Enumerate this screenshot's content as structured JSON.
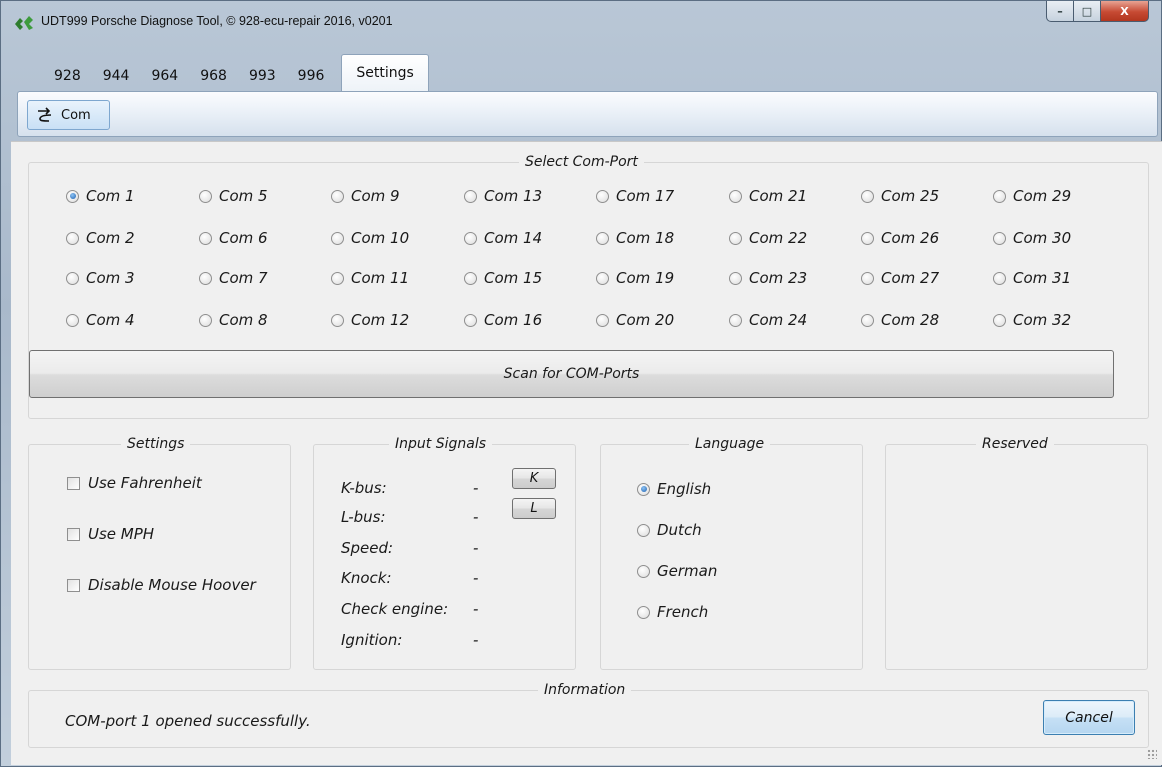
{
  "window": {
    "title": "UDT999 Porsche Diagnose Tool, © 928-ecu-repair 2016, v0201",
    "controls": {
      "minimize": "–",
      "maximize": "□",
      "close": "X"
    }
  },
  "tabs": [
    {
      "label": "928",
      "active": false
    },
    {
      "label": "944",
      "active": false
    },
    {
      "label": "964",
      "active": false
    },
    {
      "label": "968",
      "active": false
    },
    {
      "label": "993",
      "active": false
    },
    {
      "label": "996",
      "active": false
    },
    {
      "label": "Settings",
      "active": true
    }
  ],
  "ribbon": {
    "com_button": "Com"
  },
  "com_port": {
    "title": "Select Com-Port",
    "selected": "Com 1",
    "ports": [
      "Com 1",
      "Com 2",
      "Com 3",
      "Com 4",
      "Com 5",
      "Com 6",
      "Com 7",
      "Com 8",
      "Com 9",
      "Com 10",
      "Com 11",
      "Com 12",
      "Com 13",
      "Com 14",
      "Com 15",
      "Com 16",
      "Com 17",
      "Com 18",
      "Com 19",
      "Com 20",
      "Com 21",
      "Com 22",
      "Com 23",
      "Com 24",
      "Com 25",
      "Com 26",
      "Com 27",
      "Com 28",
      "Com 29",
      "Com 30",
      "Com 31",
      "Com 32"
    ],
    "scan_button": "Scan for COM-Ports"
  },
  "settings": {
    "title": "Settings",
    "options": [
      {
        "label": "Use Fahrenheit",
        "checked": false
      },
      {
        "label": "Use MPH",
        "checked": false
      },
      {
        "label": "Disable Mouse Hoover",
        "checked": false
      }
    ]
  },
  "input_signals": {
    "title": "Input Signals",
    "signals": [
      {
        "label": "K-bus:",
        "value": "-"
      },
      {
        "label": "L-bus:",
        "value": "-"
      },
      {
        "label": "Speed:",
        "value": "-"
      },
      {
        "label": "Knock:",
        "value": "-"
      },
      {
        "label": "Check engine:",
        "value": "-"
      },
      {
        "label": "Ignition:",
        "value": "-"
      }
    ],
    "k_button": "K",
    "l_button": "L"
  },
  "language": {
    "title": "Language",
    "selected": "English",
    "options": [
      "English",
      "Dutch",
      "German",
      "French"
    ]
  },
  "reserved": {
    "title": "Reserved"
  },
  "information": {
    "title": "Information",
    "message": "COM-port 1 opened successfully.",
    "cancel_button": "Cancel"
  },
  "colors": {
    "accent": "#1b5fb0",
    "panel_bg": "#f0f0f0",
    "ribbon_border": "#8ea3ba"
  }
}
